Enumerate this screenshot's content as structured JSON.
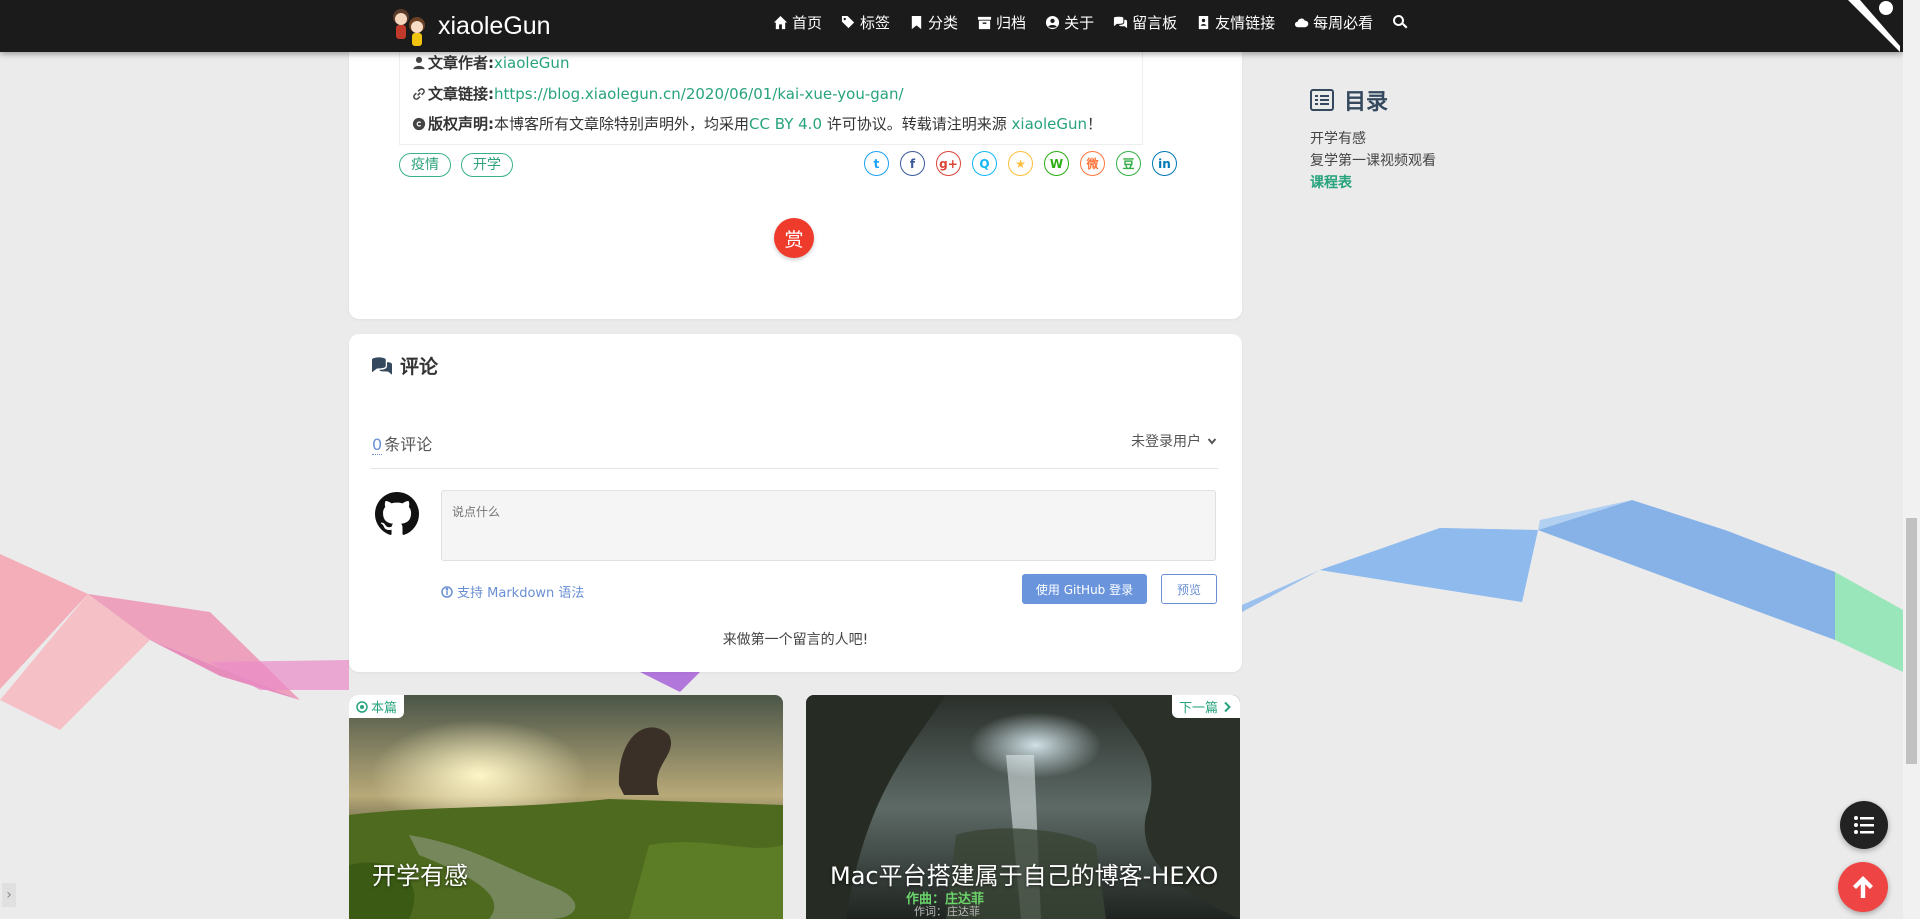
{
  "site": {
    "name": "xiaoleGun"
  },
  "nav": [
    {
      "label": "首页",
      "icon": "home-icon"
    },
    {
      "label": "标签",
      "icon": "tags-icon"
    },
    {
      "label": "分类",
      "icon": "bookmark-icon"
    },
    {
      "label": "归档",
      "icon": "archive-icon"
    },
    {
      "label": "关于",
      "icon": "user-circle-icon"
    },
    {
      "label": "留言板",
      "icon": "comments-icon"
    },
    {
      "label": "友情链接",
      "icon": "address-book-icon"
    },
    {
      "label": "每周必看",
      "icon": "cloud-icon"
    }
  ],
  "copyright": {
    "author_label": "文章作者:",
    "author": "xiaoleGun",
    "link_label": "文章链接:",
    "link": "https://blog.xiaolegun.cn/2020/06/01/kai-xue-you-gan/",
    "license_label": "版权声明:",
    "license_text_1": "本博客所有文章除特别声明外，均采用 ",
    "license_name": "CC BY 4.0",
    "license_text_2": " 许可协议。转载请注明来源 ",
    "license_source": "xiaoleGun",
    "license_text_3": "！"
  },
  "tags": [
    "疫情",
    "开学"
  ],
  "share": [
    {
      "name": "twitter",
      "glyph": "t",
      "color": "#1da1f2"
    },
    {
      "name": "facebook",
      "glyph": "f",
      "color": "#3b5998"
    },
    {
      "name": "google-plus",
      "glyph": "g+",
      "color": "#db4437"
    },
    {
      "name": "qq",
      "glyph": "Q",
      "color": "#12b7f5"
    },
    {
      "name": "qzone",
      "glyph": "★",
      "color": "#fdbe3d"
    },
    {
      "name": "wechat",
      "glyph": "W",
      "color": "#2bad13"
    },
    {
      "name": "weibo",
      "glyph": "微",
      "color": "#ff763b"
    },
    {
      "name": "douban",
      "glyph": "豆",
      "color": "#33b045"
    },
    {
      "name": "linkedin",
      "glyph": "in",
      "color": "#0077b5"
    }
  ],
  "reward": {
    "label": "赏"
  },
  "comments": {
    "title": "评论",
    "count": "0",
    "count_suffix": "条评论",
    "login_user": "未登录用户",
    "placeholder": "说点什么",
    "markdown_tip": "支持 Markdown 语法",
    "github_login": "使用 GitHub 登录",
    "preview": "预览",
    "empty_message": "来做第一个留言的人吧!"
  },
  "toc": {
    "title": "目录",
    "items": [
      {
        "label": "开学有感",
        "active": false
      },
      {
        "label": "复学第一课视频观看",
        "active": false
      },
      {
        "label": "课程表",
        "active": true
      }
    ]
  },
  "post_nav": {
    "current": {
      "badge": "本篇",
      "title": "开学有感"
    },
    "next": {
      "badge": "下一篇",
      "title": "Mac平台搭建属于自己的博客-HEXO",
      "overlay_1": "作曲：庄达菲",
      "overlay_2": "作词：庄达菲"
    }
  },
  "colors": {
    "accent": "#27a37d",
    "navbar": "#1b1b1b",
    "reward": "#ef3b2c",
    "github_button": "#6a95dd",
    "back_to_top": "#ef4444"
  }
}
